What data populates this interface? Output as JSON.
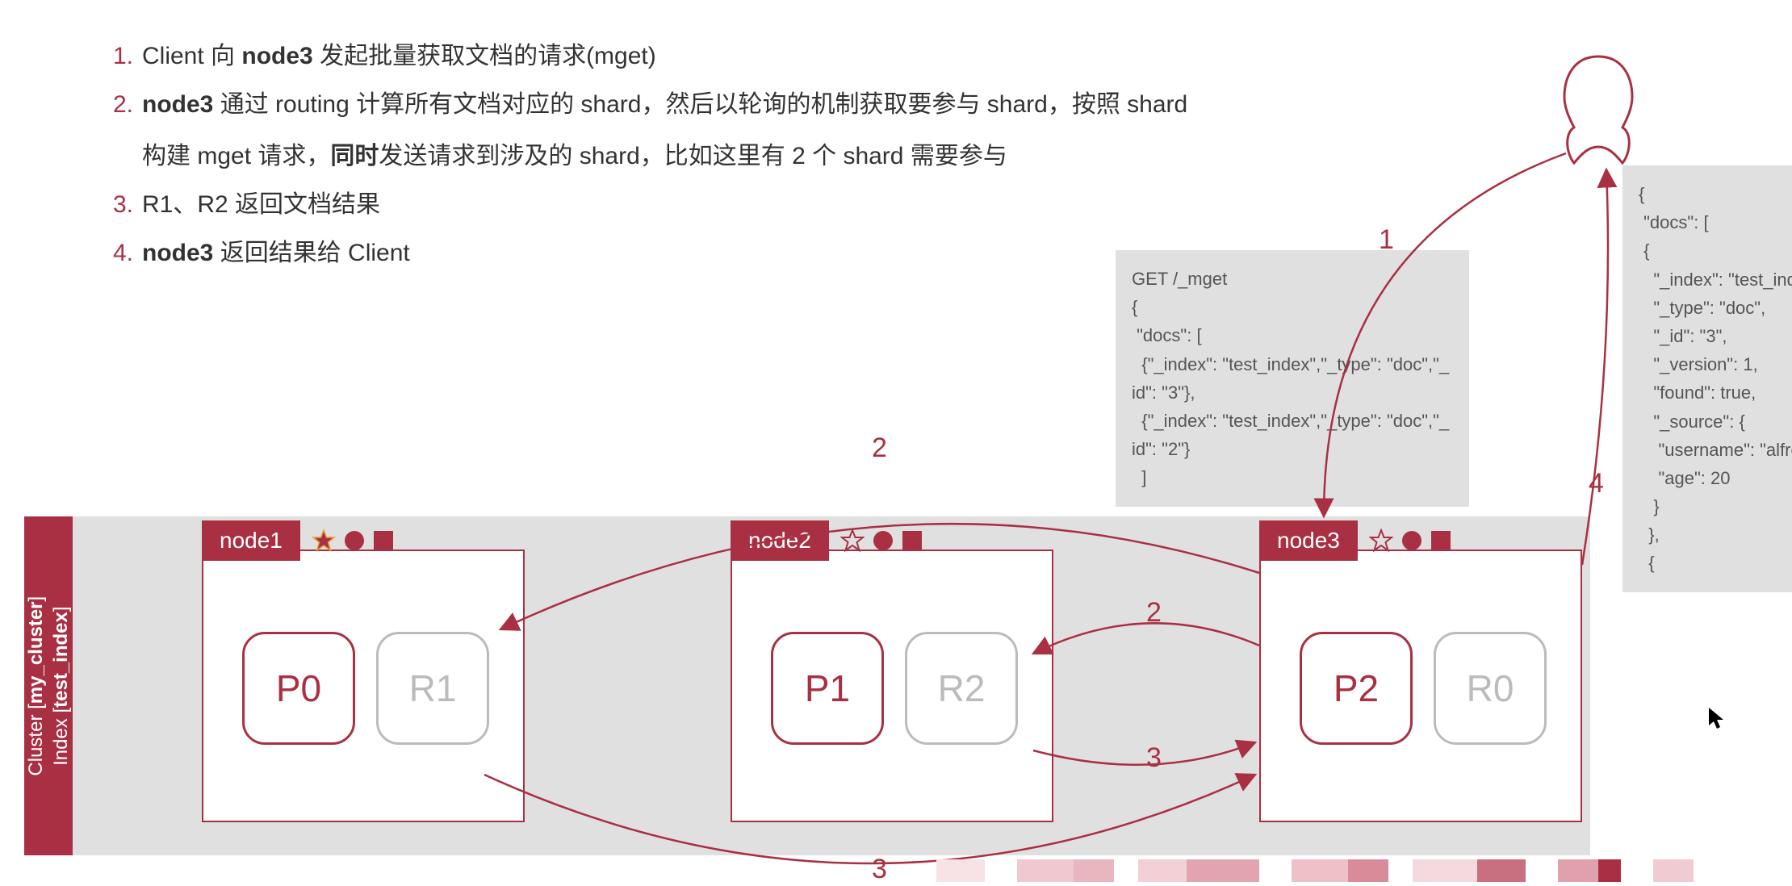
{
  "steps": {
    "items": [
      {
        "num": "1.",
        "prefix": "Client 向 ",
        "bold": "node3",
        "suffix": " 发起批量获取文档的请求(mget)"
      },
      {
        "num": "2.",
        "prefix": "",
        "bold": "node3",
        "suffix": " 通过 routing 计算所有文档对应的 shard，然后以轮询的机制获取要参与 shard，按照 shard",
        "cont_prefix": "构建 mget 请求，",
        "cont_bold": "同时",
        "cont_suffix": "发送请求到涉及的 shard，比如这里有 2 个 shard 需要参与"
      },
      {
        "num": "3.",
        "text": "R1、R2 返回文档结果"
      },
      {
        "num": "4.",
        "prefix": "",
        "bold": "node3",
        "suffix": " 返回结果给 Client"
      }
    ]
  },
  "request_box": {
    "lines": [
      "GET /_mget",
      "{",
      " \"docs\": [",
      "  {\"_index\": \"test_index\",\"_type\": \"doc\",\"_id\": \"3\"},",
      "  {\"_index\": \"test_index\",\"_type\": \"doc\",\"_id\": \"2\"}",
      "  ]"
    ]
  },
  "response_box": {
    "lines": [
      "{",
      " \"docs\": [",
      " {",
      "   \"_index\": \"test_index\",",
      "   \"_type\": \"doc\",",
      "   \"_id\": \"3\",",
      "   \"_version\": 1,",
      "   \"found\": true,",
      "   \"_source\": {",
      "    \"username\": \"alfred\",",
      "    \"age\": 20",
      "   }",
      "  },",
      "  {"
    ]
  },
  "cluster_label": {
    "line1_prefix": "Cluster [",
    "line1_bold": "my_cluster",
    "line1_suffix": "]",
    "line2_prefix": "Index [",
    "line2_bold": "test_index",
    "line2_suffix": "]"
  },
  "nodes": {
    "n1": {
      "label": "node1",
      "primary": "P0",
      "replica": "R1"
    },
    "n2": {
      "label": "node2",
      "primary": "P1",
      "replica": "R2"
    },
    "n3": {
      "label": "node3",
      "primary": "P2",
      "replica": "R0"
    }
  },
  "arrow_labels": {
    "a1": "1",
    "a2_top": "2",
    "a2_mid": "2",
    "a3_mid": "3",
    "a3_bot": "3",
    "a4": "4"
  },
  "colors": {
    "primary": "#a93043",
    "grey": "#bbbbbb",
    "bg_box": "#e0e0e0"
  }
}
